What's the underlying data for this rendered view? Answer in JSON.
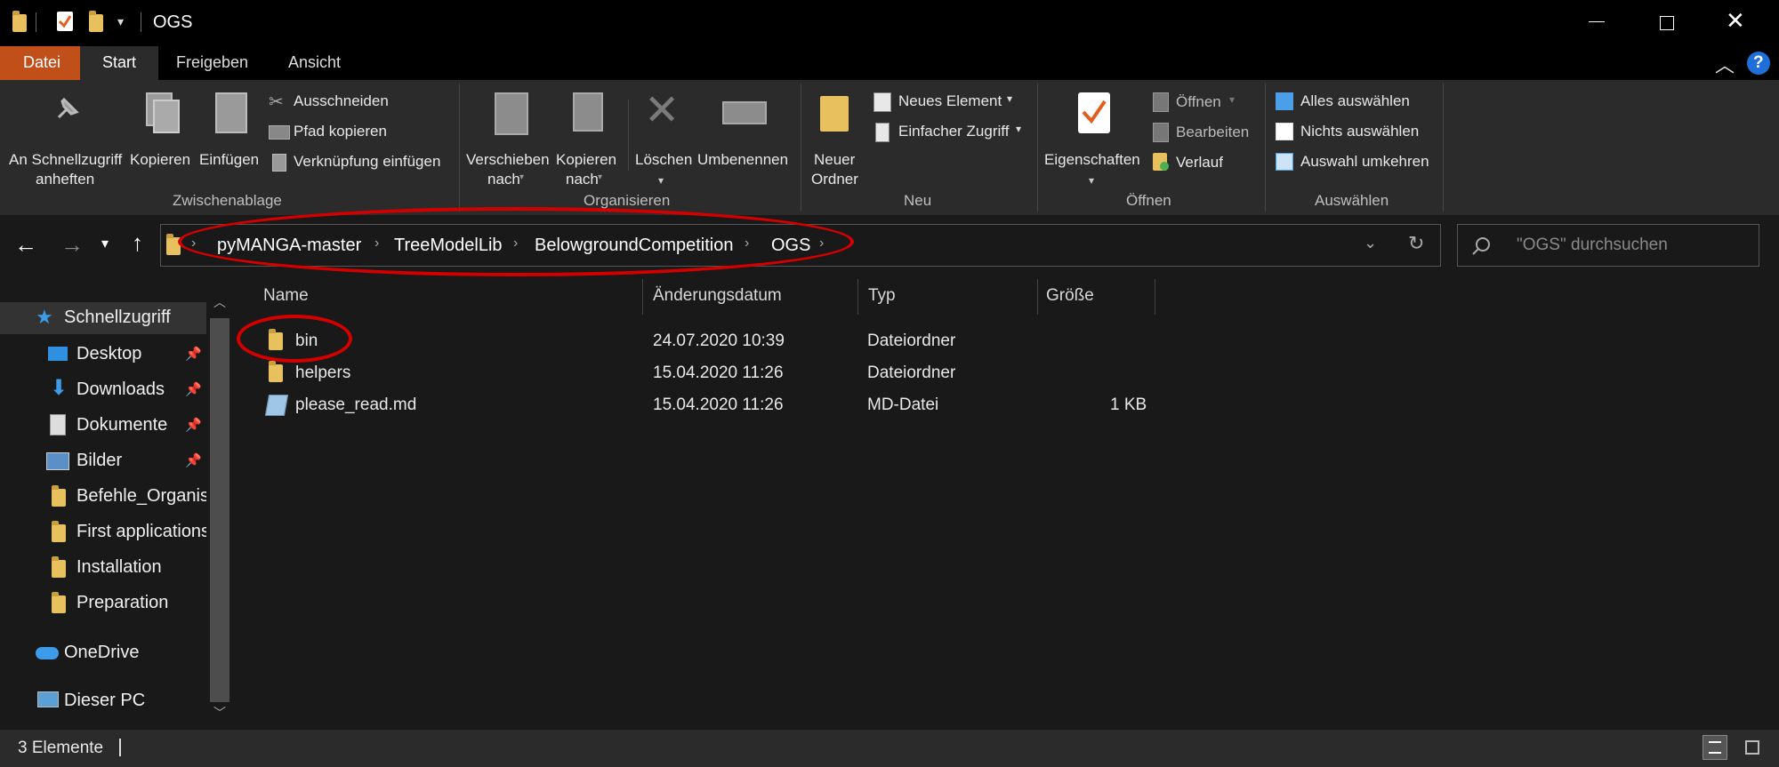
{
  "window": {
    "title": "OGS"
  },
  "tabs": [
    {
      "label": "Datei"
    },
    {
      "label": "Start"
    },
    {
      "label": "Freigeben"
    },
    {
      "label": "Ansicht"
    }
  ],
  "ribbon": {
    "clipboard": {
      "pin_label_1": "An Schnellzugriff",
      "pin_label_2": "anheften",
      "copy": "Kopieren",
      "paste": "Einfügen",
      "cut": "Ausschneiden",
      "copy_path": "Pfad kopieren",
      "paste_shortcut": "Verknüpfung einfügen",
      "group": "Zwischenablage"
    },
    "organize": {
      "move_1": "Verschieben",
      "move_2": "nach",
      "copyto_1": "Kopieren",
      "copyto_2": "nach",
      "delete": "Löschen",
      "rename": "Umbenennen",
      "group": "Organisieren"
    },
    "new": {
      "folder_1": "Neuer",
      "folder_2": "Ordner",
      "new_item": "Neues Element",
      "easy_access": "Einfacher Zugriff",
      "group": "Neu"
    },
    "open": {
      "properties": "Eigenschaften",
      "open": "Öffnen",
      "edit": "Bearbeiten",
      "history": "Verlauf",
      "group": "Öffnen"
    },
    "select": {
      "all": "Alles auswählen",
      "none": "Nichts auswählen",
      "invert": "Auswahl umkehren",
      "group": "Auswählen"
    }
  },
  "breadcrumb": [
    "pyMANGA-master",
    "TreeModelLib",
    "BelowgroundCompetition",
    "OGS"
  ],
  "search": {
    "placeholder": "\"OGS\" durchsuchen"
  },
  "sidebar": {
    "quick_access": "Schnellzugriff",
    "items": [
      {
        "label": "Desktop",
        "icon": "desktop-icon",
        "pinned": true
      },
      {
        "label": "Downloads",
        "icon": "download-icon",
        "pinned": true
      },
      {
        "label": "Dokumente",
        "icon": "document-icon",
        "pinned": true
      },
      {
        "label": "Bilder",
        "icon": "pictures-icon",
        "pinned": true
      },
      {
        "label": "Befehle_Organisa",
        "icon": "folder-icon",
        "pinned": false
      },
      {
        "label": "First applications",
        "icon": "folder-icon",
        "pinned": false
      },
      {
        "label": "Installation",
        "icon": "folder-icon",
        "pinned": false
      },
      {
        "label": "Preparation",
        "icon": "folder-icon",
        "pinned": false
      }
    ],
    "onedrive": "OneDrive",
    "this_pc": "Dieser PC"
  },
  "columns": {
    "name": "Name",
    "date": "Änderungsdatum",
    "type": "Typ",
    "size": "Größe"
  },
  "files": [
    {
      "name": "bin",
      "date": "24.07.2020 10:39",
      "type": "Dateiordner",
      "size": ""
    },
    {
      "name": "helpers",
      "date": "15.04.2020 11:26",
      "type": "Dateiordner",
      "size": ""
    },
    {
      "name": "please_read.md",
      "date": "15.04.2020 11:26",
      "type": "MD-Datei",
      "size": "1 KB"
    }
  ],
  "status": {
    "count": "3 Elemente"
  },
  "colors": {
    "accent_file_tab": "#c14f1a",
    "annotation": "#d40000",
    "help": "#1e6fd9"
  }
}
